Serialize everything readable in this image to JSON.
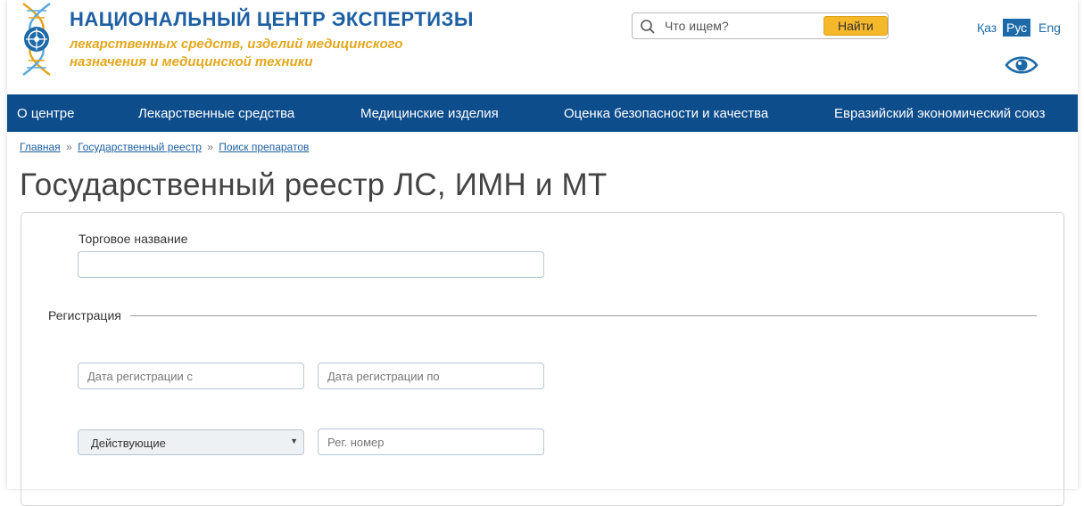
{
  "header": {
    "logo_title": "НАЦИОНАЛЬНЫЙ ЦЕНТР ЭКСПЕРТИЗЫ",
    "logo_subtitle_line1": "лекарственных средств, изделий медицинского",
    "logo_subtitle_line2": "назначения и медицинской техники",
    "search": {
      "placeholder": "Что ищем?",
      "button_label": "Найти"
    },
    "languages": {
      "kz": "Қаз",
      "ru": "Рус",
      "en": "Eng",
      "active": "ru"
    },
    "accessibility_icon": "eye-icon"
  },
  "nav": {
    "items": [
      "О центре",
      "Лекарственные средства",
      "Медицинские изделия",
      "Оценка безопасности и качества",
      "Евразийский экономический союз"
    ]
  },
  "breadcrumb": {
    "items": [
      "Главная",
      "Государственный реестр",
      "Поиск препаратов"
    ],
    "separator": "»"
  },
  "page_title": "Государственный реестр ЛС, ИМН и МТ",
  "form": {
    "trade_name_label": "Торговое название",
    "trade_name_value": "",
    "registration_section": "Регистрация",
    "date_from_placeholder": "Дата регистрации с",
    "date_to_placeholder": "Дата регистрации по",
    "status_select_value": "Действующие",
    "reg_number_placeholder": "Рег. номер"
  },
  "colors": {
    "brand_blue": "#1d5fa3",
    "nav_bg": "#0d4d8c",
    "brand_gold": "#e3a71c",
    "search_button": "#f6b82b"
  }
}
